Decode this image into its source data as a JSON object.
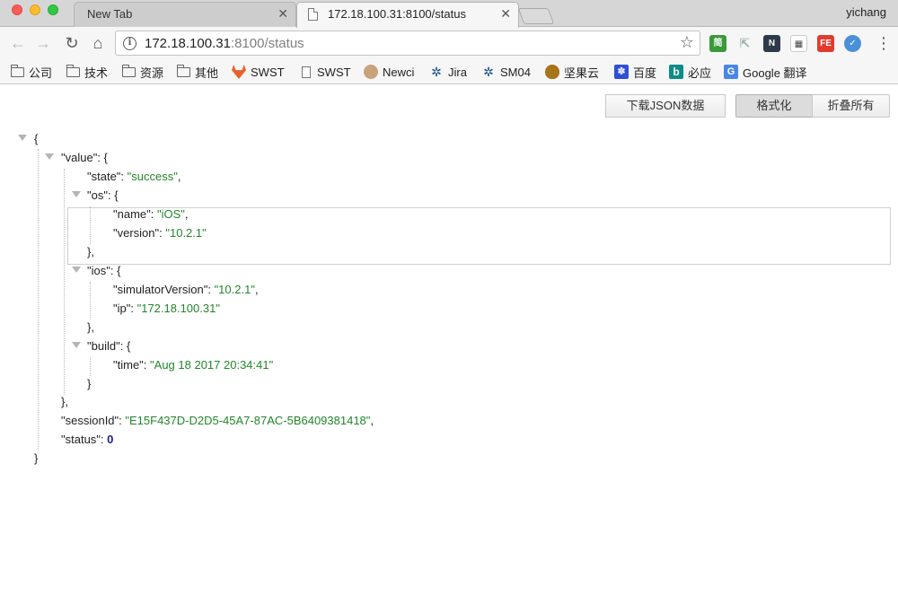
{
  "browser": {
    "tabs": [
      {
        "label": "New Tab"
      },
      {
        "label": "172.18.100.31:8100/status"
      }
    ],
    "profile_name": "yichang",
    "url": {
      "host": "172.18.100.31",
      "rest": ":8100/status"
    },
    "extensions": [
      {
        "icon": "jian-icon",
        "text": "简",
        "color": "#3a9a3a"
      },
      {
        "icon": "cursor-icon",
        "text": "",
        "color": "#9aa"
      },
      {
        "icon": "n-icon",
        "text": "N",
        "color": "#2d3a4a"
      },
      {
        "icon": "qr-icon",
        "text": "▦",
        "color": "#444"
      },
      {
        "icon": "fe-icon",
        "text": "FE",
        "color": "#e23a2d"
      },
      {
        "icon": "v-icon",
        "text": "✓",
        "color": "#4a90d9"
      }
    ],
    "bookmarks": [
      {
        "label": "公司",
        "icon": "folder-icon"
      },
      {
        "label": "技术",
        "icon": "folder-icon"
      },
      {
        "label": "资源",
        "icon": "folder-icon"
      },
      {
        "label": "其他",
        "icon": "folder-icon"
      },
      {
        "label": "SWST",
        "icon": "gitlab-icon",
        "color": "#e8622a"
      },
      {
        "label": "SWST",
        "icon": "page-icon"
      },
      {
        "label": "Newci",
        "icon": "jenkins-icon",
        "color": "#c9a27a"
      },
      {
        "label": "Jira",
        "icon": "jira-icon",
        "color": "#1a4a8a"
      },
      {
        "label": "SM04",
        "icon": "jira-icon",
        "color": "#1a4a8a"
      },
      {
        "label": "坚果云",
        "icon": "nut-icon",
        "color": "#a8741a"
      },
      {
        "label": "百度",
        "icon": "baidu-icon",
        "color": "#2f4fd9"
      },
      {
        "label": "必应",
        "icon": "bing-icon",
        "color": "#0f8a8a"
      },
      {
        "label": "Google 翻译",
        "icon": "translate-icon",
        "color": "#4a86e8"
      }
    ]
  },
  "viewer": {
    "download_label": "下载JSON数据",
    "format_label": "格式化",
    "collapse_label": "折叠所有"
  },
  "json_lines": [
    {
      "text": "{"
    },
    {
      "key": "\"value\"",
      "open": "{"
    },
    {
      "key": "\"state\"",
      "str": "\"success\"",
      "comma": true
    },
    {
      "key": "\"os\"",
      "open": "{"
    },
    {
      "key": "\"name\"",
      "str": "\"iOS\"",
      "comma": true
    },
    {
      "key": "\"version\"",
      "str": "\"10.2.1\""
    },
    {
      "text": "},"
    },
    {
      "key": "\"ios\"",
      "open": "{"
    },
    {
      "key": "\"simulatorVersion\"",
      "str": "\"10.2.1\"",
      "comma": true
    },
    {
      "key": "\"ip\"",
      "str": "\"172.18.100.31\""
    },
    {
      "text": "},"
    },
    {
      "key": "\"build\"",
      "open": "{"
    },
    {
      "key": "\"time\"",
      "str": "\"Aug 18 2017 20:34:41\""
    },
    {
      "text": "}"
    },
    {
      "text": "},"
    },
    {
      "key": "\"sessionId\"",
      "str": "\"E15F437D-D2D5-45A7-87AC-5B6409381418\"",
      "comma": true
    },
    {
      "key": "\"status\"",
      "num": "0"
    },
    {
      "text": "}"
    }
  ]
}
